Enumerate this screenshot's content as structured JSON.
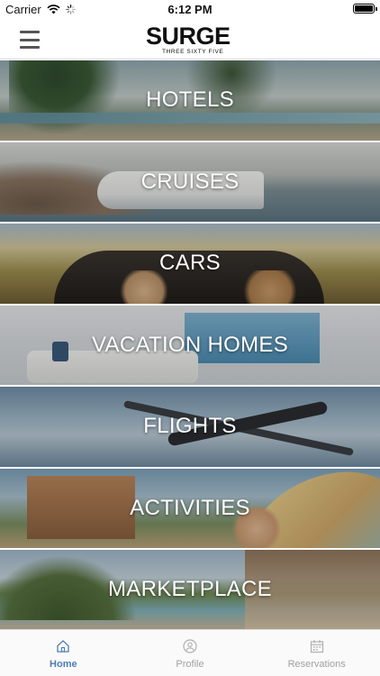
{
  "status_bar": {
    "carrier": "Carrier",
    "time": "6:12 PM"
  },
  "nav": {
    "logo_word": "SURGE",
    "logo_subtitle": "THREE SIXTY FIVE"
  },
  "categories": [
    {
      "label": "HOTELS"
    },
    {
      "label": "CRUISES"
    },
    {
      "label": "CARS"
    },
    {
      "label": "VACATION HOMES"
    },
    {
      "label": "FLIGHTS"
    },
    {
      "label": "ACTIVITIES"
    },
    {
      "label": "MARKETPLACE"
    }
  ],
  "tabs": [
    {
      "label": "Home",
      "icon": "home-icon",
      "active": true
    },
    {
      "label": "Profile",
      "icon": "profile-icon",
      "active": false
    },
    {
      "label": "Reservations",
      "icon": "calendar-icon",
      "active": false
    }
  ],
  "colors": {
    "tab_active": "#4a7fb5",
    "tab_inactive": "#a0a0a0"
  }
}
